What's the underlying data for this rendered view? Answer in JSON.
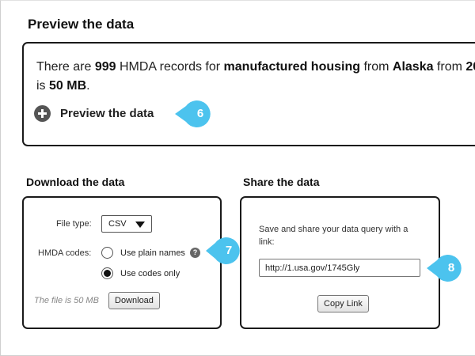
{
  "preview": {
    "section_title": "Preview the data",
    "summary": {
      "prefix": "There are ",
      "count": "999",
      "mid1": " HMDA records for ",
      "loan_type": "manufactured housing",
      "mid2": " from ",
      "state": "Alaska",
      "mid3": " from ",
      "year_partial": "20",
      "line2_prefix": "is ",
      "size": "50 MB",
      "line2_suffix": "."
    },
    "toggle_label": "Preview the data",
    "toggle_icon": "plus-circle-icon"
  },
  "download": {
    "section_title": "Download the data",
    "file_type_label": "File type:",
    "file_type_value": "CSV",
    "hmda_codes_label": "HMDA codes:",
    "options": [
      {
        "label": "Use plain names",
        "checked": false
      },
      {
        "label": "Use codes only",
        "checked": true
      }
    ],
    "help_icon_glyph": "?",
    "file_size_text": "The file is 50 MB",
    "download_button": "Download"
  },
  "share": {
    "section_title": "Share the data",
    "description": "Save and share your data query with a link:",
    "link_value": "http://1.usa.gov/1745Gly",
    "copy_button": "Copy Link"
  },
  "callouts": [
    "6",
    "7",
    "8"
  ],
  "colors": {
    "callout": "#4cc3ee",
    "border": "#1a1a1a",
    "icon_gray": "#555555"
  }
}
